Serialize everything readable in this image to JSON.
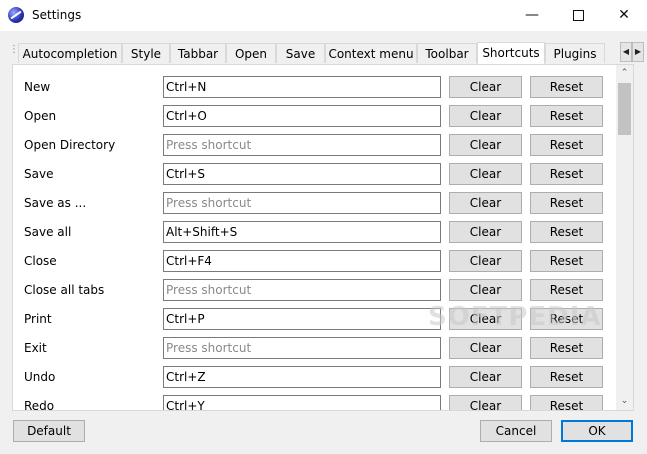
{
  "window": {
    "title": "Settings",
    "icon": "app-globe-icon"
  },
  "tabs": [
    {
      "label": "Autocompletion",
      "active": false
    },
    {
      "label": "Style",
      "active": false
    },
    {
      "label": "Tabbar",
      "active": false
    },
    {
      "label": "Open",
      "active": false
    },
    {
      "label": "Save",
      "active": false
    },
    {
      "label": "Context menu",
      "active": false
    },
    {
      "label": "Toolbar",
      "active": false
    },
    {
      "label": "Shortcuts",
      "active": true
    },
    {
      "label": "Plugins",
      "active": false
    }
  ],
  "shortcuts": {
    "clear_label": "Clear",
    "reset_label": "Reset",
    "placeholder": "Press shortcut",
    "rows": [
      {
        "label": "New",
        "value": "Ctrl+N"
      },
      {
        "label": "Open",
        "value": "Ctrl+O"
      },
      {
        "label": "Open Directory",
        "value": ""
      },
      {
        "label": "Save",
        "value": "Ctrl+S"
      },
      {
        "label": "Save as ...",
        "value": ""
      },
      {
        "label": "Save all",
        "value": "Alt+Shift+S"
      },
      {
        "label": "Close",
        "value": "Ctrl+F4"
      },
      {
        "label": "Close all tabs",
        "value": ""
      },
      {
        "label": "Print",
        "value": "Ctrl+P"
      },
      {
        "label": "Exit",
        "value": ""
      },
      {
        "label": "Undo",
        "value": "Ctrl+Z"
      },
      {
        "label": "Redo",
        "value": "Ctrl+Y"
      }
    ]
  },
  "footer": {
    "default_label": "Default",
    "cancel_label": "Cancel",
    "ok_label": "OK"
  },
  "watermark": "SOFTPEDIA",
  "colors": {
    "accent": "#0078d7",
    "button_bg": "#e1e1e1",
    "window_bg": "#f0f0f0"
  }
}
